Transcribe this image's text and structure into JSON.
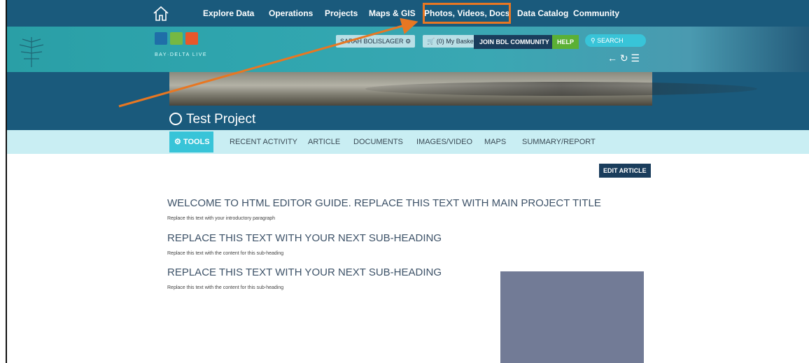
{
  "topnav": {
    "items": [
      {
        "label": "Explore Data"
      },
      {
        "label": "Operations"
      },
      {
        "label": "Projects"
      },
      {
        "label": "Maps & GIS"
      },
      {
        "label": "Photos, Videos, Docs"
      },
      {
        "label": "Data Catalog"
      },
      {
        "label": "Community"
      }
    ]
  },
  "banner": {
    "logo_text": "BAY·DELTA LIVE",
    "user": "SARAH BOLISLAGER",
    "basket": "(0) My Basket",
    "join": "JOIN BDL COMMUNITY",
    "help": "HELP",
    "search": "SEARCH",
    "logo_colors": [
      "#1f6ea8",
      "#76b843",
      "#e8572a"
    ]
  },
  "project": {
    "title": "Test Project"
  },
  "tabs": [
    {
      "label": "TOOLS"
    },
    {
      "label": "RECENT ACTIVITY"
    },
    {
      "label": "ARTICLE"
    },
    {
      "label": "DOCUMENTS"
    },
    {
      "label": "IMAGES/VIDEO"
    },
    {
      "label": "MAPS"
    },
    {
      "label": "SUMMARY/REPORT"
    }
  ],
  "content": {
    "edit_button": "EDIT ARTICLE",
    "main_heading": "WELCOME TO HTML EDITOR GUIDE. REPLACE THIS TEXT WITH MAIN PROJECT TITLE",
    "intro": "Replace this text with your introductory paragraph",
    "sub1": "REPLACE THIS TEXT WITH YOUR NEXT SUB-HEADING",
    "sub1_text": "Replace this text with the content for this sub-heading",
    "sub2": "REPLACE THIS TEXT WITH YOUR NEXT SUB-HEADING",
    "sub2_text": "Replace this text with the content for this sub-heading"
  },
  "colors": {
    "nav_bg": "#1a5a7c",
    "highlight": "#e87722",
    "accent": "#38c4d8"
  }
}
